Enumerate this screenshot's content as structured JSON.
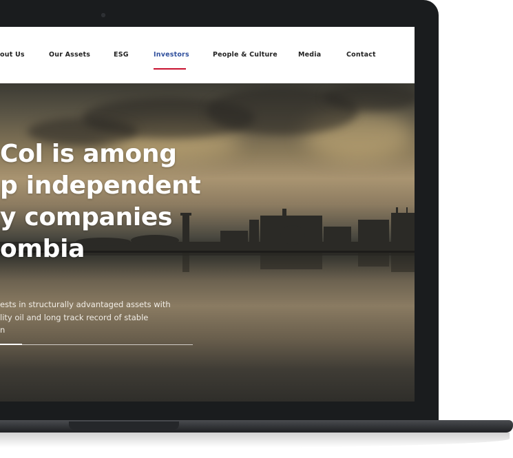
{
  "nav": {
    "items": [
      {
        "label": "out Us",
        "active": false
      },
      {
        "label": "Our Assets",
        "active": false
      },
      {
        "label": "ESG",
        "active": false
      },
      {
        "label": "Investors",
        "active": true
      },
      {
        "label": "People & Culture",
        "active": false
      },
      {
        "label": "Media",
        "active": false
      },
      {
        "label": "Contact",
        "active": false
      }
    ],
    "active_color": "#2f4f9c",
    "underline_color": "#c8102e"
  },
  "hero": {
    "headline_lines": [
      "Col is among",
      "p independent",
      "y companies",
      "ombia"
    ],
    "subtext_lines": [
      "ests in structurally advantaged assets with",
      "lity oil and long track record of stable",
      "n"
    ]
  }
}
